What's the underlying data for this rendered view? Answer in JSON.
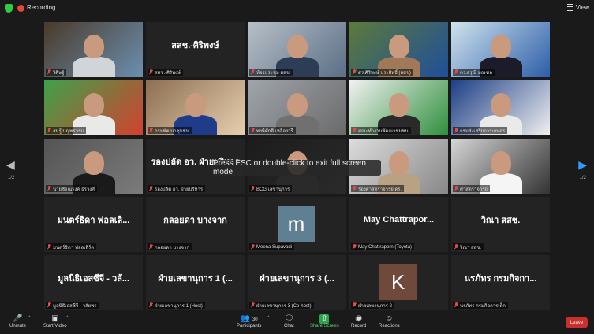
{
  "topbar": {
    "recording_label": "Recording",
    "view_label": "View"
  },
  "tiles": [
    {
      "label": "วิศิษฐ์",
      "name": "",
      "kind": "photo",
      "colors": [
        "#4a3a2a",
        "#6b8fb0",
        "#d1d5d8"
      ]
    },
    {
      "label": "สสช.-ศิริพงษ์",
      "name": "สสช.-ศิริพงษ์",
      "kind": "name"
    },
    {
      "label": "ห้องประชุม สสช.",
      "name": "",
      "kind": "photo",
      "colors": [
        "#b7bfc7",
        "#5b6f86",
        "#2d3d55"
      ]
    },
    {
      "label": "ดร.ศิริพงษ์ ประสิทธิ์ (สสช)",
      "name": "",
      "kind": "photo",
      "colors": [
        "#5c7a3a",
        "#1f4e9b",
        "#a07a58"
      ]
    },
    {
      "label": "ดร.อรุณี มณฑล",
      "name": "",
      "kind": "photo",
      "colors": [
        "#cfe3ee",
        "#2c5ea8",
        "#1b1b2a"
      ]
    },
    {
      "label": "สมรู้ บุญพรวรม",
      "name": "",
      "kind": "photo",
      "colors": [
        "#3da24a",
        "#d4402f",
        "#e9e9e9"
      ]
    },
    {
      "label": "กรมพัฒนาชุมชน",
      "name": "",
      "kind": "photo",
      "colors": [
        "#8d6f52",
        "#e6cfae",
        "#1e3c8a"
      ]
    },
    {
      "label": "พงษ์ศักดิ์ เหลืองวรี",
      "name": "",
      "kind": "photo",
      "colors": [
        "#9fa5ab",
        "#6a6a6a",
        "#707070"
      ]
    },
    {
      "label": "คณะทำงานพัฒนาชุมชน",
      "name": "",
      "kind": "photo",
      "colors": [
        "#f1f1f1",
        "#2f8f3c",
        "#2a2a2a"
      ]
    },
    {
      "label": "กรมส่งเสริมการเกษตร",
      "name": "",
      "kind": "photo",
      "colors": [
        "#1d3f86",
        "#f0f0f0",
        "#eaeaea"
      ]
    },
    {
      "label": "นายชัยณรงค์ ธีรวงศ์",
      "name": "",
      "kind": "photo",
      "colors": [
        "#545454",
        "#7b7b7b",
        "#1a1a1a"
      ],
      "speaking": true
    },
    {
      "label": "รองปลัด อว. ฝ่ายบริหาร",
      "name": "รองปลัด อว. ฝ่ายบริหาร",
      "kind": "name"
    },
    {
      "label": "BCG เลขานุการ",
      "name": "",
      "kind": "photo",
      "colors": [
        "#1c1c1c",
        "#2a2a2a",
        "#2a2a2a"
      ]
    },
    {
      "label": "รองศาสตราจารย์ ดร.",
      "name": "",
      "kind": "photo",
      "colors": [
        "#dcdcdc",
        "#888",
        "#b9a183"
      ]
    },
    {
      "label": "ศาสตราจารย์",
      "name": "",
      "kind": "photo",
      "colors": [
        "#d6d6d6",
        "#333",
        "#f5f5f5"
      ]
    },
    {
      "label": "มนตร์ธิดา ฟอลเลิร์ต",
      "name": "มนตร์ธิดา ฟอลเลิ...",
      "kind": "name"
    },
    {
      "label": "กลอยดา บางจาก",
      "name": "กลอยดา บางจาก",
      "kind": "name"
    },
    {
      "label": "Meena Supavadi",
      "name": "",
      "kind": "avatar",
      "initial": "m",
      "color": "#5f7f93"
    },
    {
      "label": "May Chattraporn (Toyota)",
      "name": "May  Chattrapor...",
      "kind": "name"
    },
    {
      "label": "วิณา สสช.",
      "name": "วิณา สสช.",
      "kind": "name"
    },
    {
      "label": "มูลนิธิเอสซีจี - วลัยพร",
      "name": "มูลนิธิเอสซีจี - วลั...",
      "kind": "name"
    },
    {
      "label": "ฝ่ายเลขานุการ 1 (Host)",
      "name": "ฝ่ายเลขานุการ 1 (...",
      "kind": "name"
    },
    {
      "label": "ฝ่ายเลขานุการ 3 (Co-host)",
      "name": "ฝ่ายเลขานุการ 3 (...",
      "kind": "name"
    },
    {
      "label": "ฝ่ายเลขานุการ 2",
      "name": "",
      "kind": "avatar",
      "initial": "K",
      "color": "#6f4a3b"
    },
    {
      "label": "นรภัทร กรมกิจการเด็ก",
      "name": "นรภัทร กรมกิจกา...",
      "kind": "name"
    }
  ],
  "toast": "Press ESC or double-click to exit full screen mode",
  "pager": {
    "left": "1/2",
    "right": "1/2"
  },
  "toolbar": {
    "unmute": "Unmute",
    "start_video": "Start Video",
    "participants": "Participants",
    "participants_count": "30",
    "chat": "Chat",
    "share_screen": "Share Screen",
    "record": "Record",
    "reactions": "Reactions",
    "leave": "Leave"
  }
}
